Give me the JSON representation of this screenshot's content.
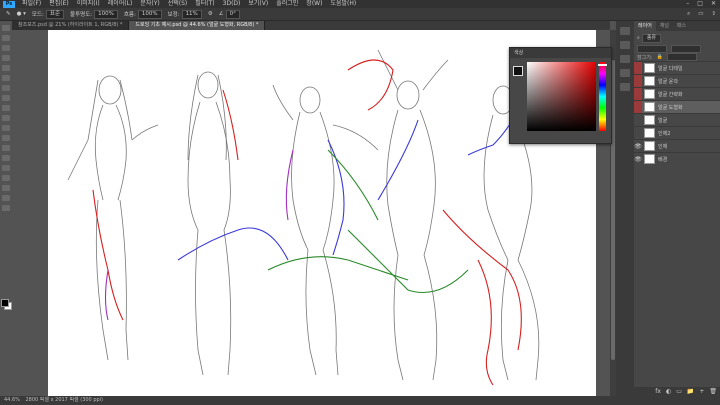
{
  "menubar": {
    "items": [
      "파일(F)",
      "편집(E)",
      "이미지(I)",
      "레이어(L)",
      "문자(Y)",
      "선택(S)",
      "필터(T)",
      "3D(D)",
      "보기(V)",
      "플러그인",
      "창(W)",
      "도움말(H)"
    ],
    "window_controls": [
      "–",
      "□",
      "✕"
    ]
  },
  "options": {
    "mode_label": "모드:",
    "mode_value": "표준",
    "opacity_label": "불투명도:",
    "opacity_value": "100%",
    "flow_label": "흐름:",
    "flow_value": "100%",
    "smoothing_label": "보정:",
    "smoothing_value": "11%",
    "angle_value": "0°"
  },
  "tabs": [
    {
      "label": "참조포즈.psd @ 21% (하이라이트 1, RGB/8) *"
    },
    {
      "label": "드로잉 기초 예시.psd @ 44.6% (얼굴 도형화, RGB/8) *"
    }
  ],
  "status": {
    "zoom": "44.6%",
    "doc": "2800 픽셀 x 2017 픽셀 (300 ppi)"
  },
  "layers_panel": {
    "tabs": [
      "레이어",
      "채널",
      "패스"
    ],
    "kind_filter": "종류",
    "lock_label": "잠그기:",
    "layers": [
      {
        "name": "얼굴 디테일",
        "visible": false,
        "tag": true,
        "selected": false
      },
      {
        "name": "얼굴 윤곽",
        "visible": false,
        "tag": true,
        "selected": false
      },
      {
        "name": "얼굴 간략화",
        "visible": false,
        "tag": true,
        "selected": false
      },
      {
        "name": "얼굴 도형화",
        "visible": false,
        "tag": true,
        "selected": true
      },
      {
        "name": "얼굴",
        "visible": false,
        "tag": false,
        "selected": false
      },
      {
        "name": "인체2",
        "visible": false,
        "tag": false,
        "selected": false
      },
      {
        "name": "인체",
        "visible": true,
        "tag": false,
        "selected": false
      },
      {
        "name": "배경",
        "visible": true,
        "tag": false,
        "selected": false
      }
    ],
    "footer_icons": [
      "fx",
      "◐",
      "▭",
      "📁",
      "+",
      "🗑"
    ]
  },
  "color_panel": {
    "title": "색상",
    "fg_color": "#111111",
    "bg_color": "#ffffff",
    "hue": "#e60000"
  },
  "colors": {
    "accent": "#31a8ff",
    "layer_tag": "#9a3a3a",
    "sketch_red": "#d62020",
    "sketch_blue": "#3a3ad8",
    "sketch_green": "#2a8a2a",
    "sketch_purple": "#a030c0"
  }
}
